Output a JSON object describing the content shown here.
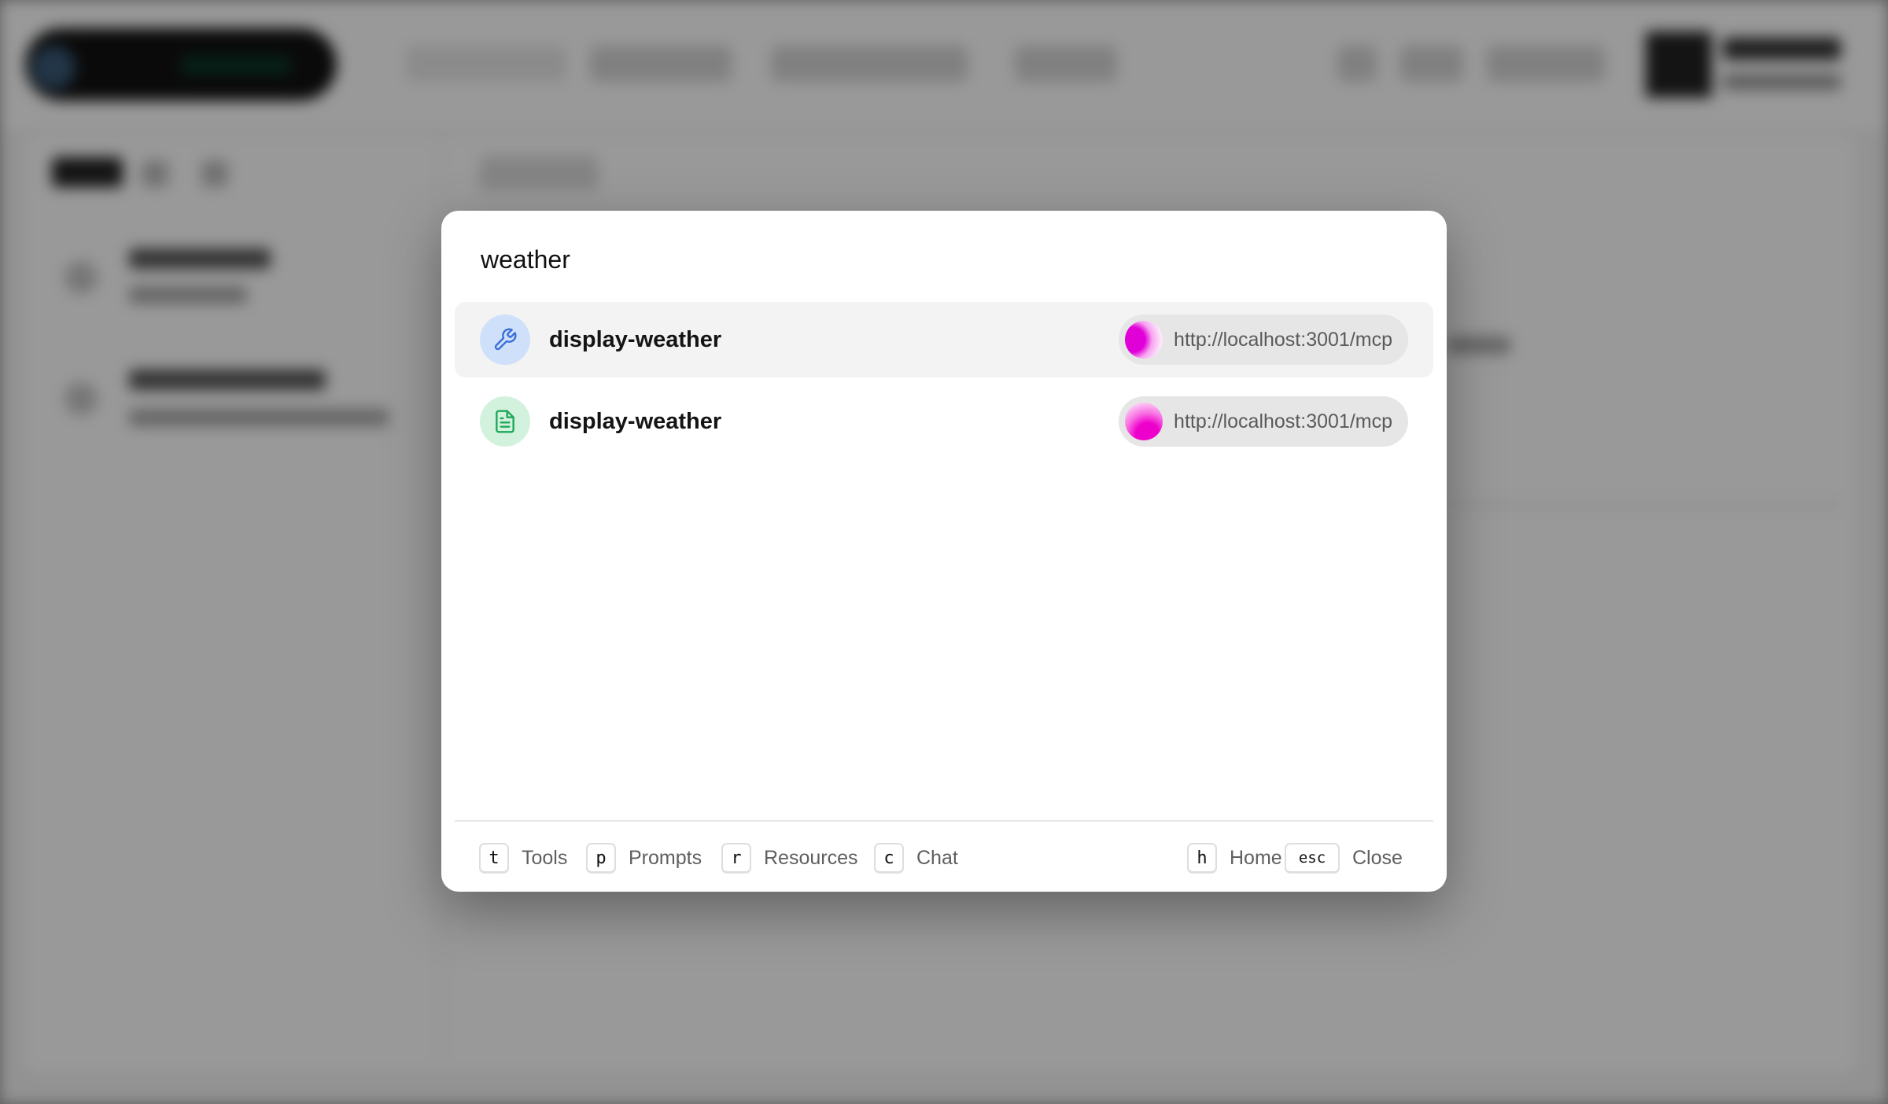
{
  "search": {
    "query": "weather"
  },
  "results": [
    {
      "type": "tool",
      "icon": "wrench-icon",
      "name": "display-weather",
      "server_url": "http://localhost:3001/mcp",
      "selected": true
    },
    {
      "type": "resource",
      "icon": "document-icon",
      "name": "display-weather",
      "server_url": "http://localhost:3001/mcp",
      "selected": false
    }
  ],
  "shortcuts": {
    "tools": {
      "key": "t",
      "label": "Tools"
    },
    "prompts": {
      "key": "p",
      "label": "Prompts"
    },
    "resources": {
      "key": "r",
      "label": "Resources"
    },
    "chat": {
      "key": "c",
      "label": "Chat"
    },
    "home": {
      "key": "h",
      "label": "Home"
    },
    "close": {
      "key": "esc",
      "label": "Close"
    }
  },
  "colors": {
    "tool_icon_bg": "#cfe0fa",
    "tool_icon_fg": "#3b6fd8",
    "resource_icon_bg": "#d3f2de",
    "resource_icon_fg": "#1fa85a",
    "selected_row_bg": "#f3f3f3",
    "server_chip_bg": "#e6e6e6"
  }
}
